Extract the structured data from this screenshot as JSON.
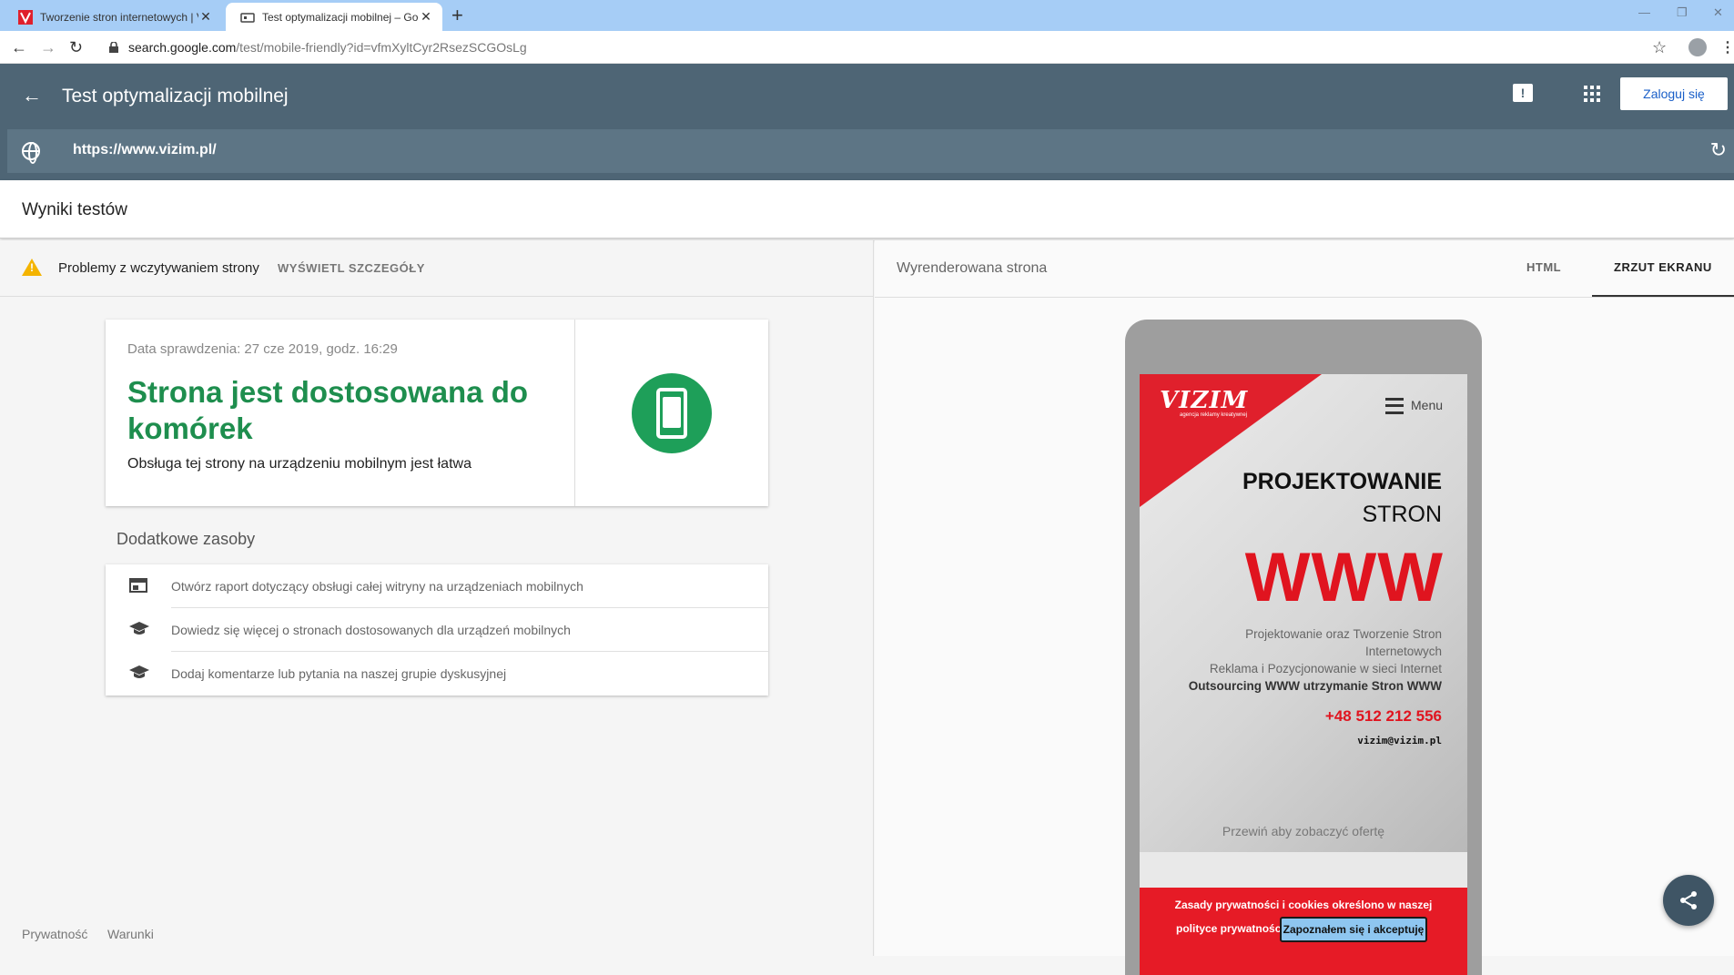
{
  "browser": {
    "tabs": [
      {
        "title": "Tworzenie stron internetowych | V",
        "active": false
      },
      {
        "title": "Test optymalizacji mobilnej – Goo",
        "active": true
      }
    ],
    "new_tab": "+",
    "url_host": "search.google.com",
    "url_path": "/test/mobile-friendly?id=vfmXyltCyr2RsezSCGOsLg"
  },
  "header": {
    "title": "Test optymalizacji mobilnej",
    "signin_label": "Zaloguj się",
    "tested_url": "https://www.vizim.pl/"
  },
  "results": {
    "title": "Wyniki testów",
    "issue_text": "Problemy z wczytywaniem strony",
    "details_link": "WYŚWIETL SZCZEGÓŁY",
    "check_date": "Data sprawdzenia: 27 cze 2019, godz. 16:29",
    "headline": "Strona jest dostosowana do komórek",
    "subtext": "Obsługa tej strony na urządzeniu mobilnym jest łatwa"
  },
  "resources": {
    "heading": "Dodatkowe zasoby",
    "items": [
      {
        "label": "Otwórz raport dotyczący obsługi całej witryny na urządzeniach mobilnych",
        "icon": "report-icon"
      },
      {
        "label": "Dowiedz się więcej o stronach dostosowanych dla urządzeń mobilnych",
        "icon": "school-icon"
      },
      {
        "label": "Dodaj komentarze lub pytania na naszej grupie dyskusyjnej",
        "icon": "school-icon"
      }
    ]
  },
  "footer": {
    "privacy": "Prywatność",
    "terms": "Warunki"
  },
  "rendered": {
    "label": "Wyrenderowana strona",
    "tab_html": "HTML",
    "tab_screenshot": "ZRZUT EKRANU"
  },
  "preview": {
    "logo": "VIZIM",
    "logo_tag": "agencja reklamy kreatywnej",
    "menu_label": "Menu",
    "title_line1": "PROJEKTOWANIE",
    "title_line2": "STRON",
    "title_www": "WWW",
    "lines": [
      "Projektowanie oraz Tworzenie Stron",
      "Internetowych",
      "Reklama i Pozycjonowanie w sieci Internet",
      "Outsourcing WWW utrzymanie Stron WWW"
    ],
    "phone": "+48 512 212 556",
    "email": "vizim@vizim.pl",
    "scroll_hint": "Przewiń aby zobaczyć ofertę",
    "cookie_text1": "Zasady prywatności i cookies określono w naszej",
    "cookie_text2": "polityce prywatności",
    "cookie_button": "Zapoznałem się i akceptuję"
  },
  "colors": {
    "header_bg": "#4e6575",
    "success_green": "#1e8e4e",
    "warning_yellow": "#f4b400",
    "brand_red": "#e0141f"
  }
}
